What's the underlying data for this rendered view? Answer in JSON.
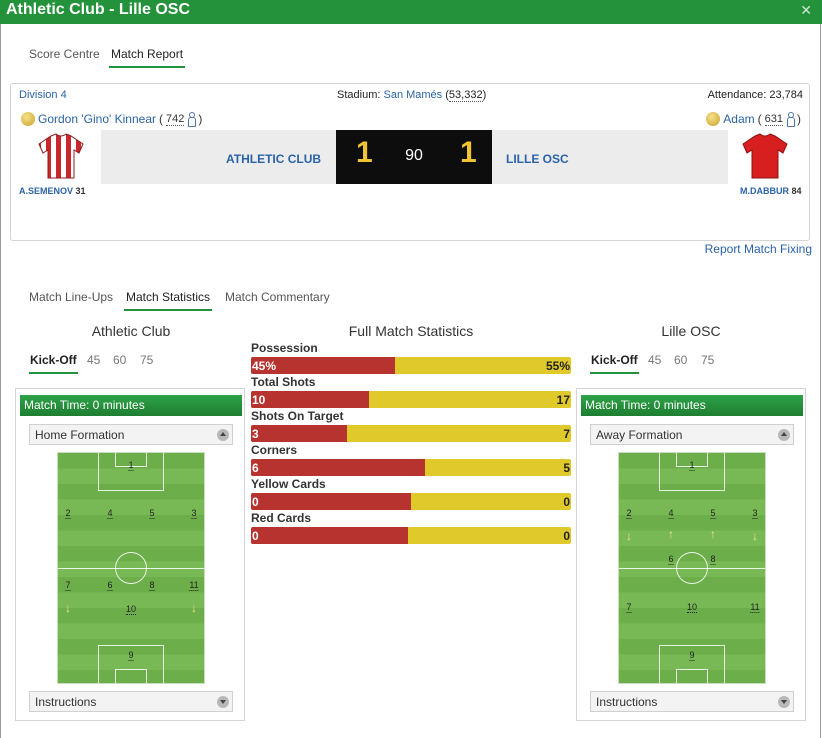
{
  "window": {
    "title": "Athletic Club - Lille OSC",
    "close_glyph": "✕"
  },
  "top_tabs": {
    "score_centre": "Score Centre",
    "match_report": "Match Report"
  },
  "match": {
    "division": "Division 4",
    "stadium_label": "Stadium:",
    "stadium_name": "San Mamés",
    "stadium_capacity": "53,332",
    "attendance_label": "Attendance:",
    "attendance": "23,784",
    "home_manager": "Gordon 'Gino' Kinnear",
    "home_manager_rating": "742",
    "away_manager": "Adam",
    "away_manager_rating": "631",
    "home_team": "ATHLETIC CLUB",
    "away_team": "LILLE OSC",
    "home_score": "1",
    "away_score": "1",
    "minute": "90",
    "home_scorer": "A.SEMENOV",
    "home_scorer_minute": "31",
    "away_scorer": "M.DABBUR",
    "away_scorer_minute": "84",
    "home_shirt_colors": [
      "#c8282d",
      "#ffffff"
    ],
    "away_shirt_color": "#d81f1f"
  },
  "report_fixing": "Report Match Fixing",
  "sub_tabs": {
    "lineups": "Match Line-Ups",
    "statistics": "Match Statistics",
    "commentary": "Match Commentary"
  },
  "home_side": {
    "name": "Athletic Club",
    "time_tabs": [
      "Kick-Off",
      "45",
      "60",
      "75"
    ],
    "match_time": "Match Time: 0 minutes",
    "formation_label": "Home Formation",
    "instructions": "Instructions"
  },
  "away_side": {
    "name": "Lille OSC",
    "time_tabs": [
      "Kick-Off",
      "45",
      "60",
      "75"
    ],
    "match_time": "Match Time: 0 minutes",
    "formation_label": "Away Formation",
    "instructions": "Instructions"
  },
  "stats": {
    "title": "Full Match Statistics",
    "rows": [
      {
        "label": "Possession",
        "home": "45%",
        "away": "55%",
        "home_share": 0.45
      },
      {
        "label": "Total Shots",
        "home": "10",
        "away": "17",
        "home_share": 0.37
      },
      {
        "label": "Shots On Target",
        "home": "3",
        "away": "7",
        "home_share": 0.3
      },
      {
        "label": "Corners",
        "home": "6",
        "away": "5",
        "home_share": 0.545
      },
      {
        "label": "Yellow Cards",
        "home": "0",
        "away": "0",
        "home_share": 0.5
      },
      {
        "label": "Red Cards",
        "home": "0",
        "away": "0",
        "home_share": 0.49
      }
    ]
  },
  "home_positions": [
    "1",
    "2",
    "4",
    "5",
    "3",
    "7",
    "6",
    "8",
    "11",
    "10",
    "9"
  ],
  "away_positions": [
    "1",
    "2",
    "4",
    "5",
    "3",
    "6",
    "8",
    "7",
    "10",
    "11",
    "9"
  ],
  "colors": {
    "brand_green": "#23923a",
    "link_blue": "#2a63a8",
    "home_bar": "#b73330",
    "away_bar": "#dfc92b",
    "score_digit": "#f1c232"
  }
}
